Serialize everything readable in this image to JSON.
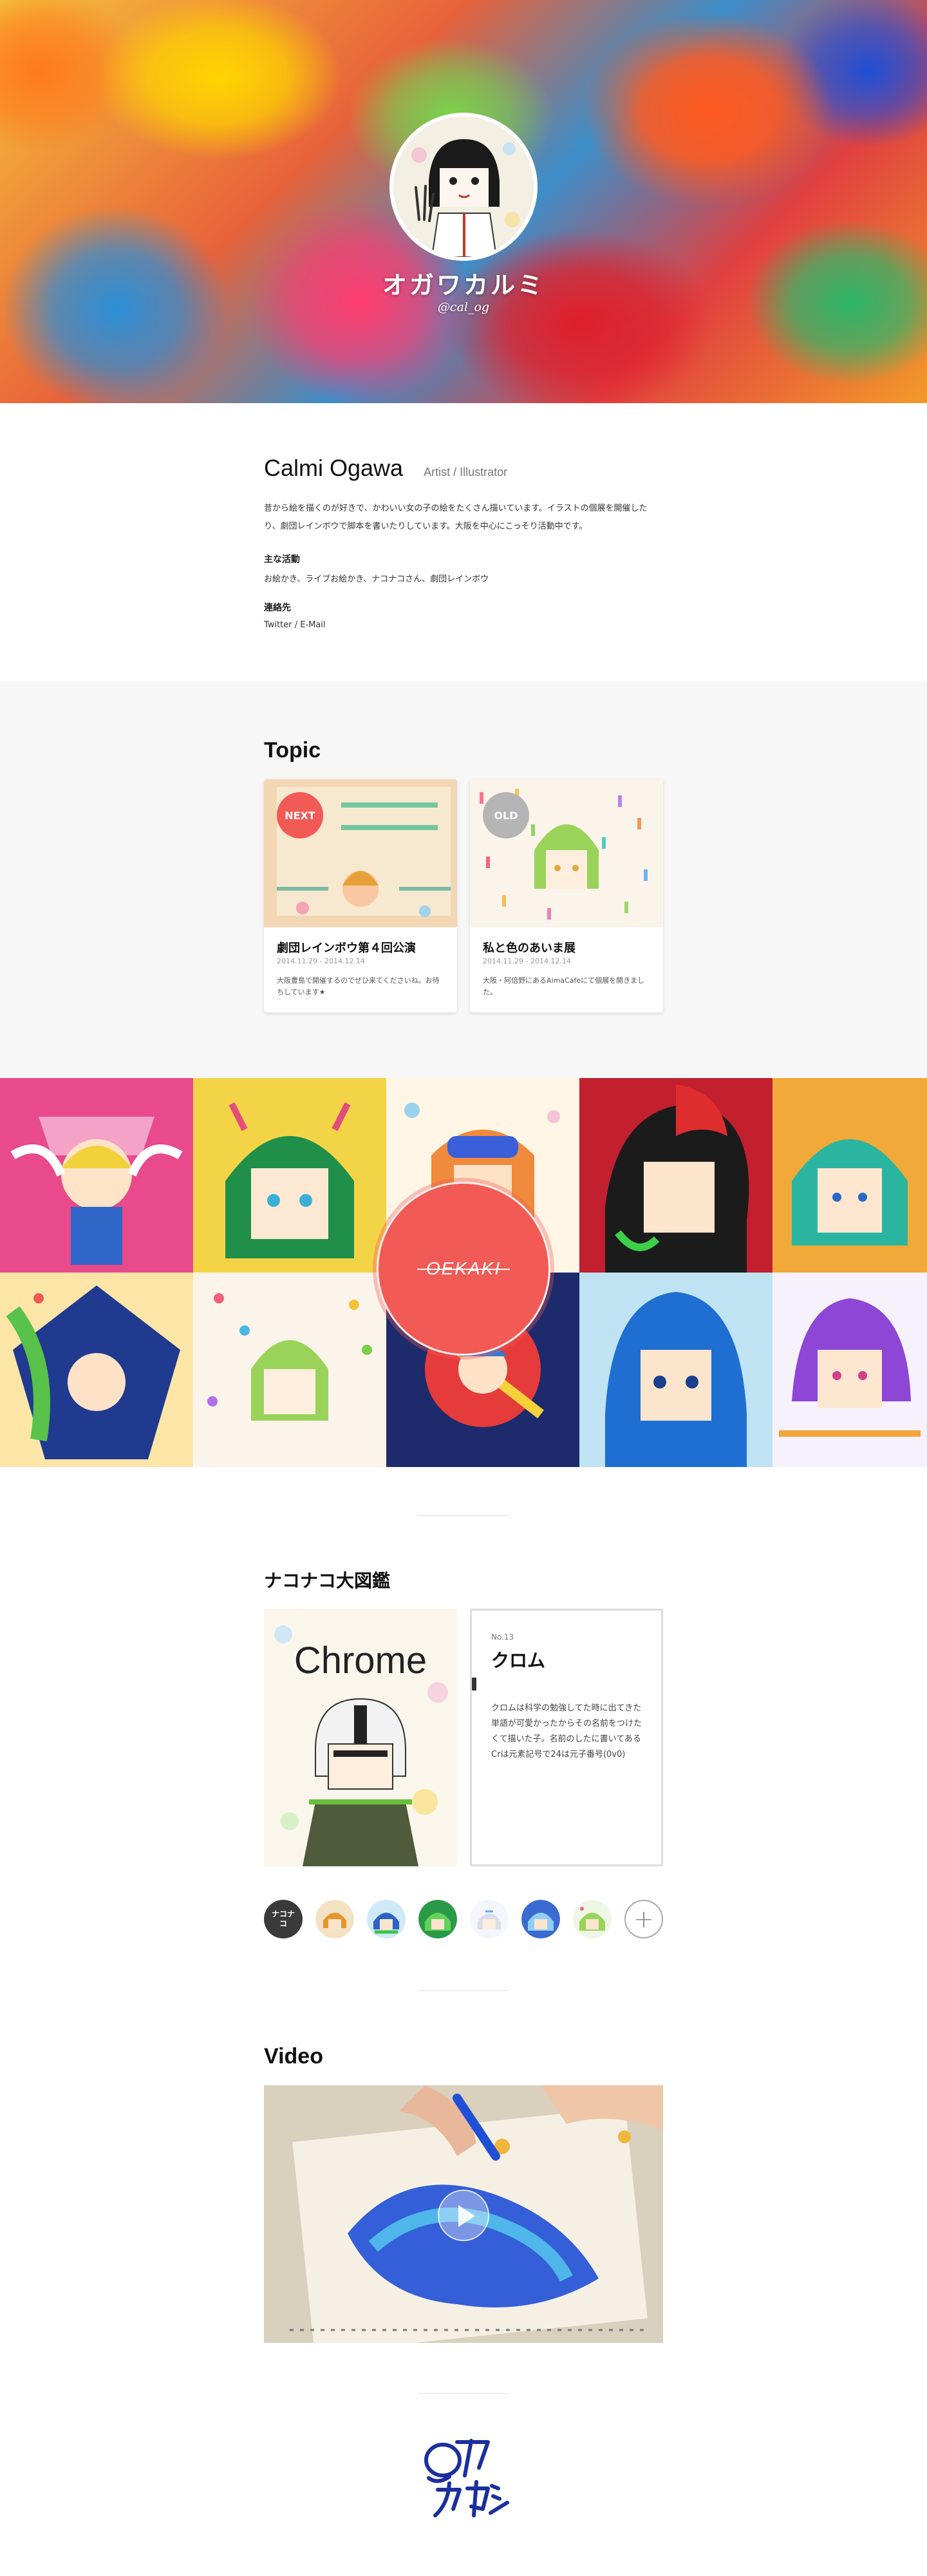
{
  "hero": {
    "name": "オガワカルミ",
    "handle": "@cal_og"
  },
  "profile": {
    "name": "Calmi Ogawa",
    "role": "Artist / Illustrator",
    "description": "昔から絵を描くのが好きで、かわいい女の子の絵をたくさん描いています。イラストの個展を開催したり、劇団レインボウで脚本を書いたりしています。大阪を中心にこっそり活動中です。",
    "activities_heading": "主な活動",
    "activities": "お絵かき、ライブお絵かき、ナコナコさん、劇団レインボウ",
    "contact_heading": "連絡先",
    "contact": "Twitter / E-Mail"
  },
  "topic": {
    "title": "Topic",
    "cards": [
      {
        "badge": "NEXT",
        "badge_color": "#f25a55",
        "title": "劇団レインボウ第４回公演",
        "date": "2014.11.29 - 2014.12.14",
        "desc": "大阪豊島で開催するのでぜひ来てくださいね。お待ちしています★"
      },
      {
        "badge": "OLD",
        "badge_color": "#b5b5b5",
        "title": "私と色のあいま展",
        "date": "2014.11.29 - 2014.12.14",
        "desc": "大阪・阿倍野にあるAimaCafeにて個展を開きました。"
      }
    ]
  },
  "gallery": {
    "button": "OEKAKI"
  },
  "zukan": {
    "title": "ナコナコ大図鑑",
    "number": "No.13",
    "name": "クロム",
    "description": "クロムは科学の勉強してた時に出てきた単語が可愛かったからその名前をつけたくて描いた子。名前のしたに書いてあるCrは元素記号で24は元子番号(0v0)",
    "image_text": "Chrome",
    "active_thumb": "ナコナコ",
    "add_label": "+"
  },
  "video": {
    "title": "Video"
  },
  "colors": {
    "accent": "#f25a55",
    "topic_bg": "#f7f7f7",
    "logo": "#1b2f9e"
  }
}
